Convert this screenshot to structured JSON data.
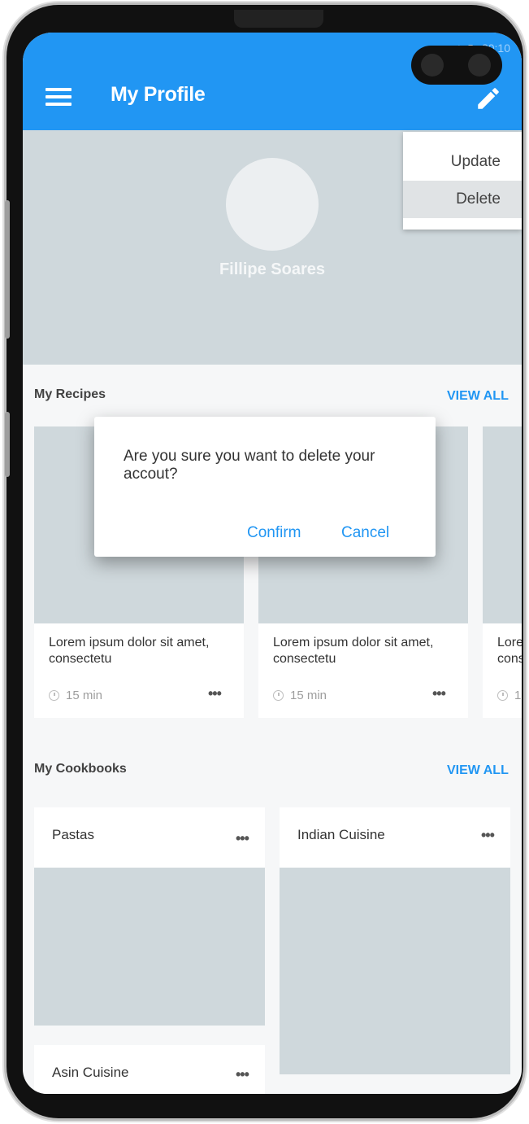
{
  "status": {
    "time": "20:10"
  },
  "appbar": {
    "title": "My Profile"
  },
  "menu": {
    "items": [
      "Update",
      "Delete"
    ]
  },
  "profile": {
    "name": "Fillipe Soares"
  },
  "recipes": {
    "title": "My Recipes",
    "view_all": "VIEW ALL",
    "cards": [
      {
        "text": "Lorem ipsum dolor sit amet, consectetu",
        "time": "15 min",
        "more": "•••"
      },
      {
        "text": "Lorem ipsum dolor sit amet, consectetu",
        "time": "15 min",
        "more": "•••"
      },
      {
        "text": "Lorem ipsum dolor sit amet, consectetu",
        "time": "15 min",
        "more": "•••"
      }
    ]
  },
  "cookbooks": {
    "title": "My Cookbooks",
    "view_all": "VIEW ALL",
    "cards": [
      {
        "title": "Pastas",
        "more": "•••"
      },
      {
        "title": "Indian Cuisine",
        "more": "•••"
      },
      {
        "title": "Asin Cuisine",
        "more": "•••"
      }
    ]
  },
  "dialog": {
    "message": "Are you sure you want to delete your accout?",
    "confirm": "Confirm",
    "cancel": "Cancel"
  },
  "colors": {
    "primary": "#2196f3",
    "placeholder": "#cfd8dc"
  },
  "icons": [
    "hamburger-menu-icon",
    "edit-pencil-icon",
    "clock-icon",
    "more-dots-icon",
    "wifi-icon",
    "signal-icon",
    "battery-icon"
  ]
}
